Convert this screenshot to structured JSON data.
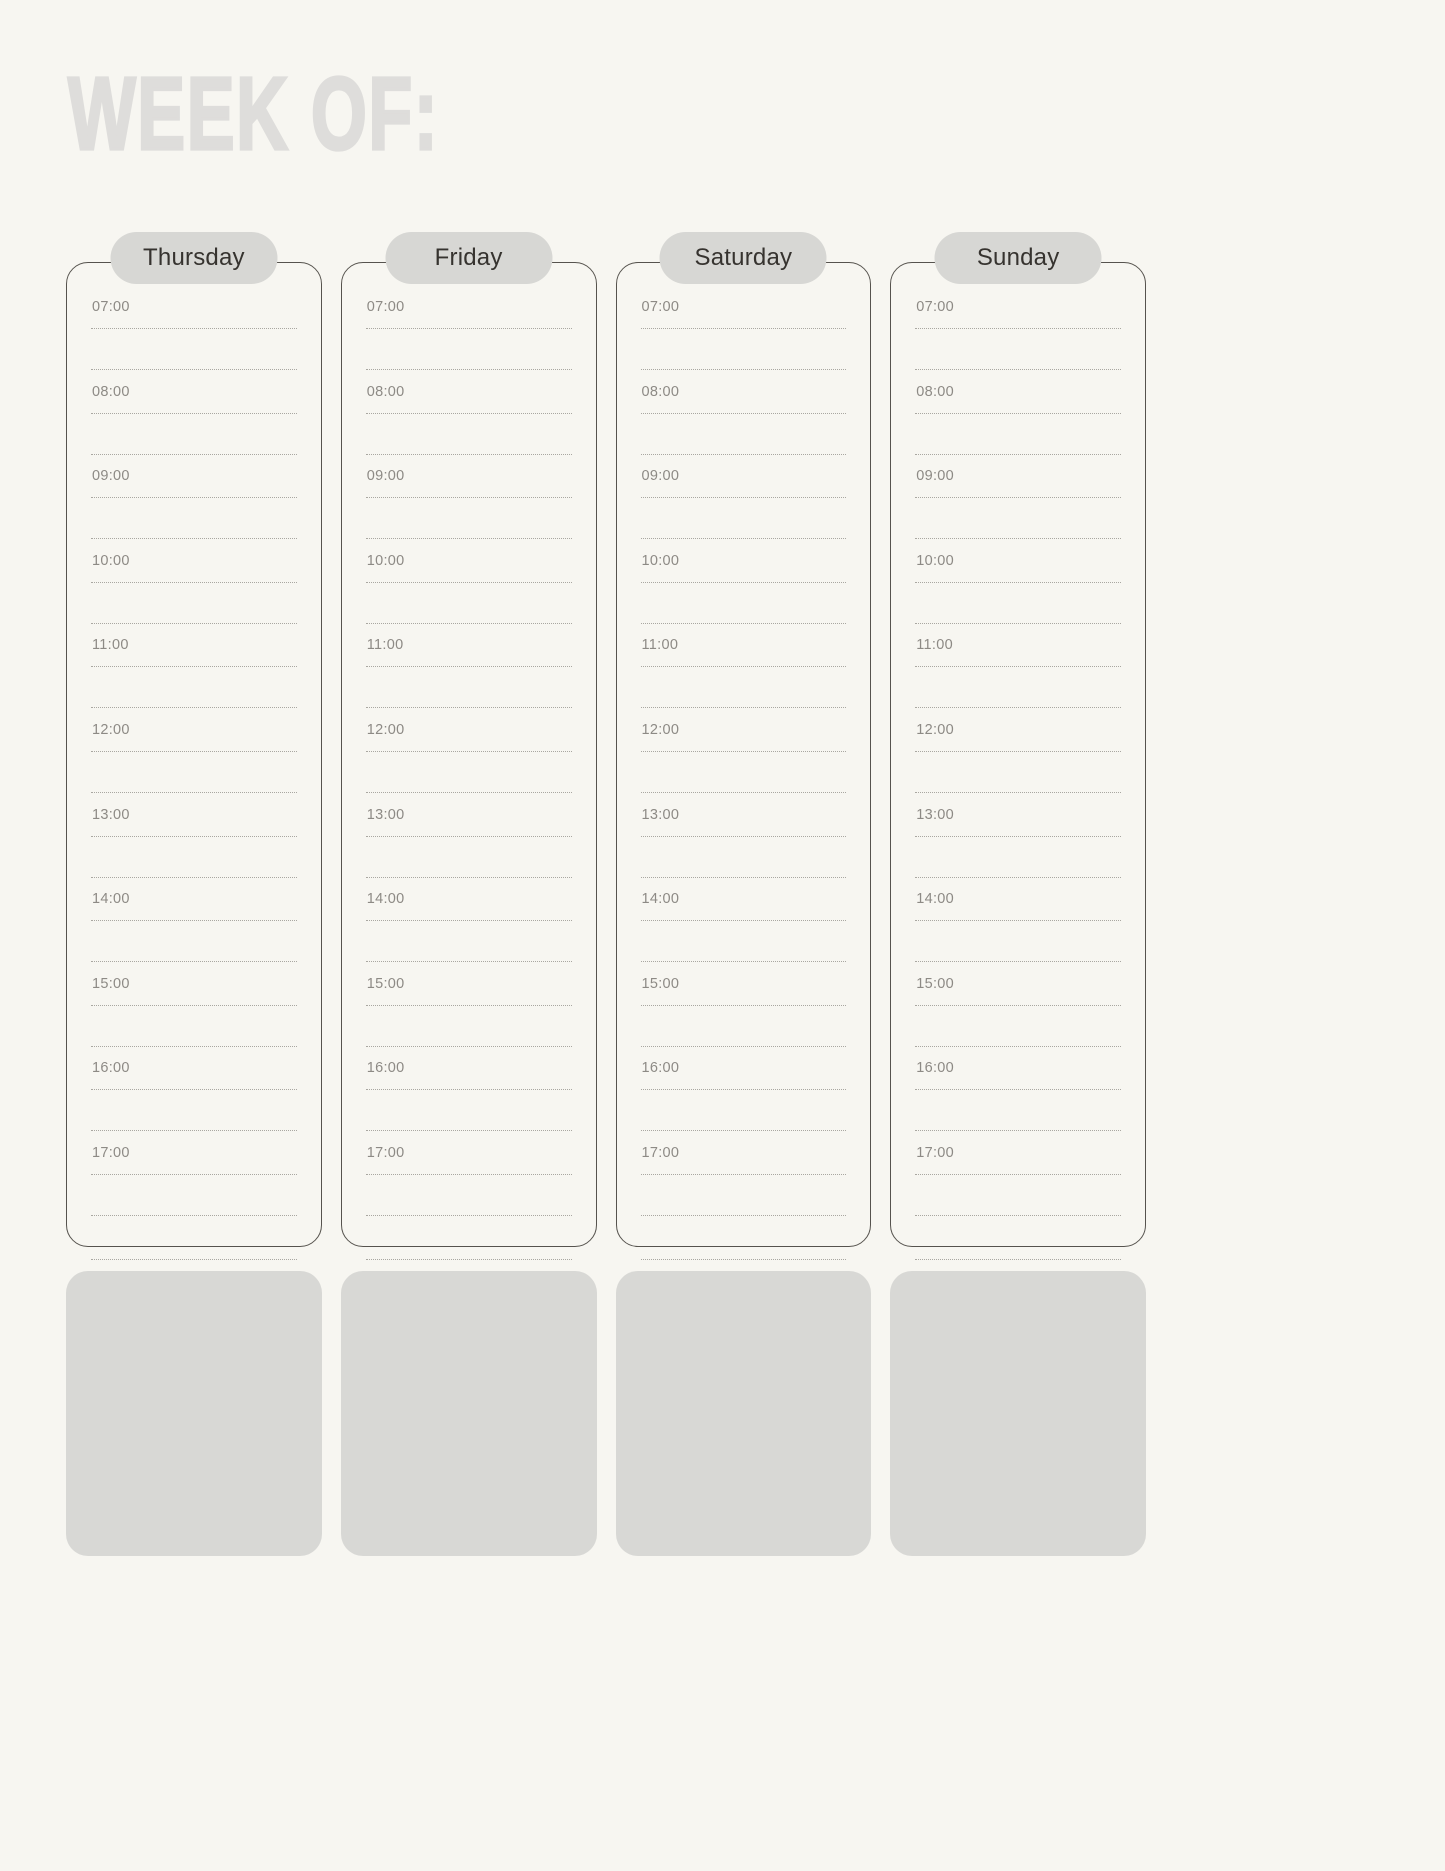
{
  "page": {
    "title": "WEEK OF:",
    "background_color": "#f7f6f1",
    "title_color": "#dedddb",
    "card_border_color": "#56534e",
    "pill_color": "#d7d7d4",
    "note_box_color": "#d8d8d5",
    "rule_color": "#a9a7a1",
    "time_label_color": "#8d8a85"
  },
  "columns": [
    {
      "day": "Thursday",
      "times": [
        "07:00",
        "08:00",
        "09:00",
        "10:00",
        "11:00",
        "12:00",
        "13:00",
        "14:00",
        "15:00",
        "16:00",
        "17:00"
      ],
      "note": ""
    },
    {
      "day": "Friday",
      "times": [
        "07:00",
        "08:00",
        "09:00",
        "10:00",
        "11:00",
        "12:00",
        "13:00",
        "14:00",
        "15:00",
        "16:00",
        "17:00"
      ],
      "note": ""
    },
    {
      "day": "Saturday",
      "times": [
        "07:00",
        "08:00",
        "09:00",
        "10:00",
        "11:00",
        "12:00",
        "13:00",
        "14:00",
        "15:00",
        "16:00",
        "17:00"
      ],
      "note": ""
    },
    {
      "day": "Sunday",
      "times": [
        "07:00",
        "08:00",
        "09:00",
        "10:00",
        "11:00",
        "12:00",
        "13:00",
        "14:00",
        "15:00",
        "16:00",
        "17:00"
      ],
      "note": ""
    }
  ]
}
